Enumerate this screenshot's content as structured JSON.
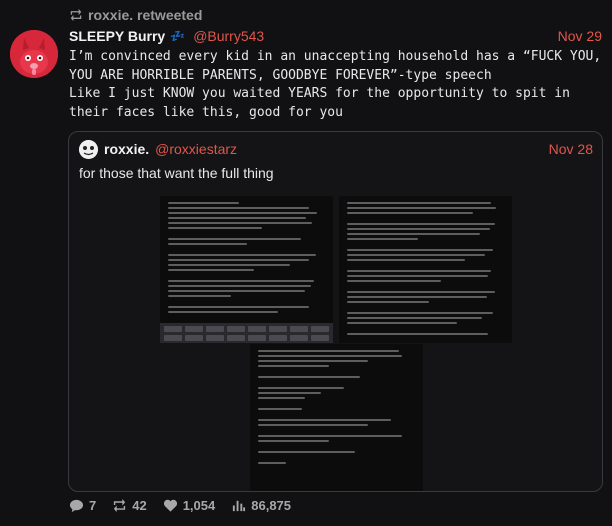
{
  "retweet": {
    "label": "roxxie. retweeted"
  },
  "tweet": {
    "display_name": "SLEEPY Burry",
    "name_emoji": "💤",
    "handle": "@Burry543",
    "date": "Nov 29",
    "text": "I’m convinced every kid in an unaccepting household has a “FUCK YOU,\nYOU ARE HORRIBLE PARENTS, GOODBYE FOREVER”-type speech\nLike I just KNOW you waited YEARS for the opportunity to spit in\ntheir faces like this, good for you"
  },
  "quote": {
    "display_name": "roxxie.",
    "handle": "@roxxiestarz",
    "date": "Nov 28",
    "text": "for those that want the full thing"
  },
  "stats": {
    "replies": "7",
    "retweets": "42",
    "likes": "1,054",
    "views": "86,875"
  },
  "colors": {
    "background": "#111113",
    "accent": "#e0564b",
    "avatar": "#d6283a",
    "muted": "#9a9a9a"
  },
  "icons": {
    "retweet": "retweet-icon",
    "reply": "reply-icon",
    "like": "heart-icon",
    "views": "views-icon"
  }
}
